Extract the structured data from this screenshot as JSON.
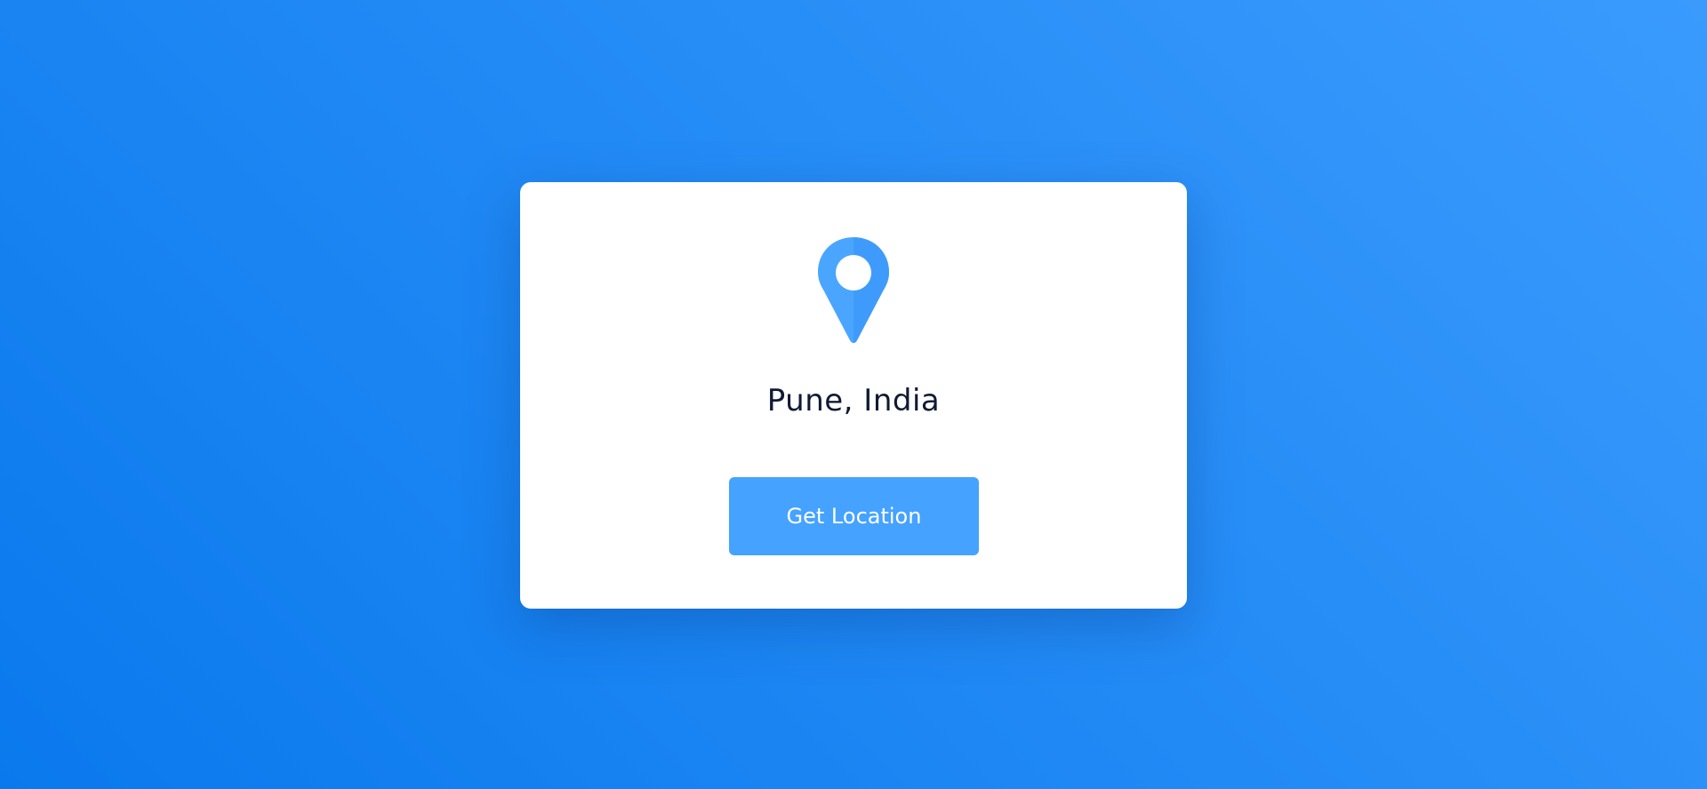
{
  "card": {
    "icon": "map-pin-icon",
    "location_text": "Pune, India",
    "button_label": "Get Location"
  },
  "colors": {
    "background_start": "#0a79ed",
    "background_end": "#3a9bfd",
    "accent": "#45a2ff",
    "pin": "#4aa5ff",
    "text": "#0f1b33"
  }
}
